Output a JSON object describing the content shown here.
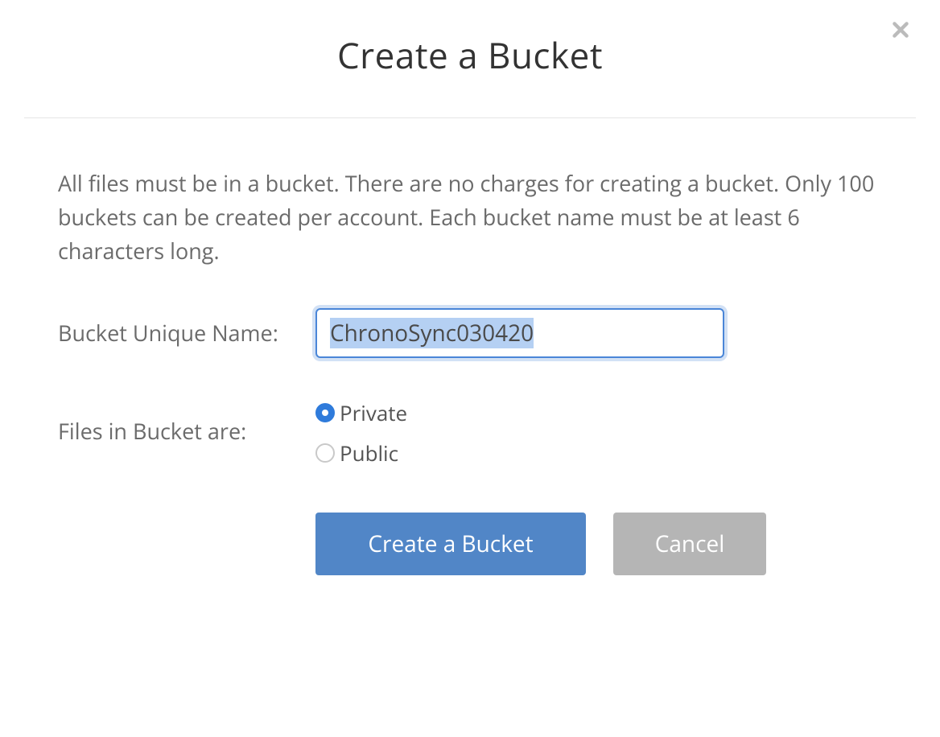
{
  "modal": {
    "title": "Create a Bucket",
    "description": "All files must be in a bucket. There are no charges for creating a bucket. Only 100 buckets can be created per account. Each bucket name must be at least 6 characters long.",
    "bucketNameLabel": "Bucket Unique Name:",
    "bucketNameValue": "ChronoSync030420",
    "filesLabel": "Files in Bucket are:",
    "radioOptions": {
      "private": "Private",
      "public": "Public"
    },
    "buttons": {
      "create": "Create a Bucket",
      "cancel": "Cancel"
    }
  }
}
